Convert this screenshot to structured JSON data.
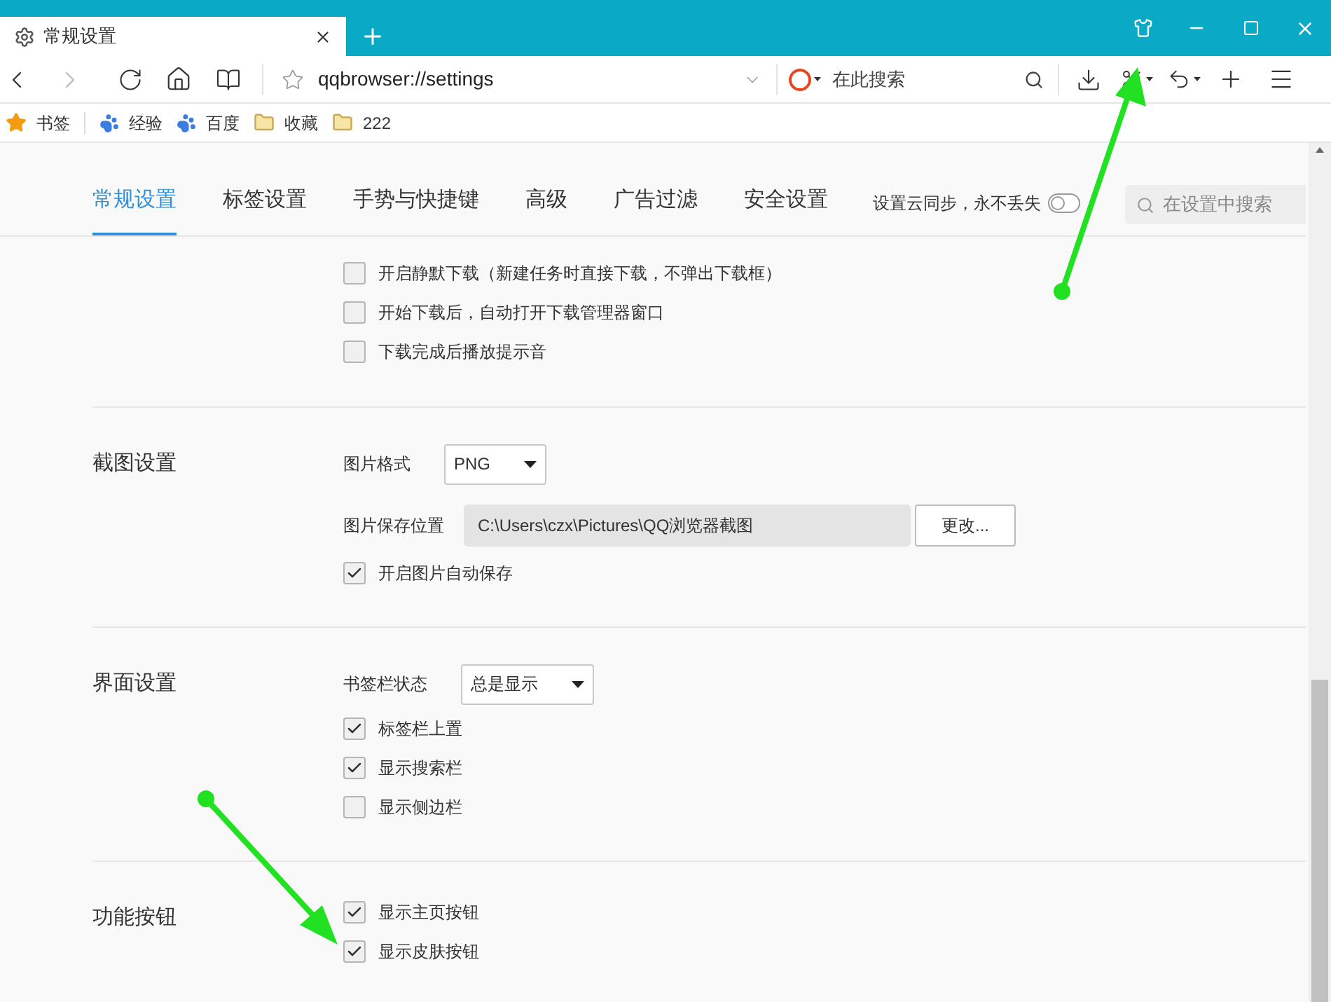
{
  "window": {
    "tab_title": "常规设置"
  },
  "address_bar": {
    "url": "qqbrowser://settings"
  },
  "search_box": {
    "placeholder": "在此搜索"
  },
  "bookmarks": [
    {
      "kind": "star",
      "label": "书签"
    },
    {
      "kind": "paw",
      "label": "经验"
    },
    {
      "kind": "paw",
      "label": "百度"
    },
    {
      "kind": "folder",
      "label": "收藏"
    },
    {
      "kind": "folder",
      "label": "222"
    }
  ],
  "settings_tabs": [
    {
      "label": "常规设置",
      "selected": true
    },
    {
      "label": "标签设置",
      "selected": false
    },
    {
      "label": "手势与快捷键",
      "selected": false
    },
    {
      "label": "高级",
      "selected": false
    },
    {
      "label": "广告过滤",
      "selected": false
    },
    {
      "label": "安全设置",
      "selected": false
    }
  ],
  "sync": {
    "label": "设置云同步，永不丢失",
    "on": false
  },
  "settings_search": {
    "placeholder": "在设置中搜索"
  },
  "sections": [
    {
      "items": [
        {
          "kind": "checkbox",
          "label": "开启静默下载（新建任务时直接下载，不弹出下载框）",
          "checked": false
        },
        {
          "kind": "checkbox",
          "label": "开始下载后，自动打开下载管理器窗口",
          "checked": false
        },
        {
          "kind": "checkbox",
          "label": "下载完成后播放提示音",
          "checked": false
        }
      ]
    },
    {
      "title": "截图设置",
      "items": [
        {
          "kind": "select",
          "label": "图片格式",
          "value": "PNG"
        },
        {
          "kind": "path",
          "label": "图片保存位置",
          "value": "C:\\Users\\czx\\Pictures\\QQ浏览器截图",
          "button": "更改..."
        },
        {
          "kind": "checkbox",
          "label": "开启图片自动保存",
          "checked": true
        }
      ]
    },
    {
      "title": "界面设置",
      "items": [
        {
          "kind": "select",
          "label": "书签栏状态",
          "value": "总是显示"
        },
        {
          "kind": "checkbox",
          "label": "标签栏上置",
          "checked": true
        },
        {
          "kind": "checkbox",
          "label": "显示搜索栏",
          "checked": true
        },
        {
          "kind": "checkbox",
          "label": "显示侧边栏",
          "checked": false
        }
      ]
    },
    {
      "title": "功能按钮",
      "items": [
        {
          "kind": "checkbox",
          "label": "显示主页按钮",
          "checked": true
        },
        {
          "kind": "checkbox",
          "label": "显示皮肤按钮",
          "checked": true
        }
      ]
    }
  ]
}
